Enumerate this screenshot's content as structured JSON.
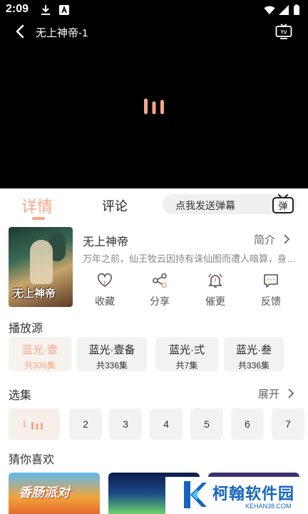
{
  "status_bar": {
    "time": "2:09"
  },
  "player": {
    "title": "无上神帝-1"
  },
  "tabs": {
    "detail": "详情",
    "comment": "评论"
  },
  "danmu": {
    "placeholder": "点我发送弹幕",
    "icon_label": "弹"
  },
  "show": {
    "poster_logo": "无上神帝",
    "title": "无上神帝",
    "intro_label": "简介",
    "description": "万年之前，仙王牧云因持有诛仙图而遭人暗算，身死道消。"
  },
  "actions": [
    {
      "label": "收藏",
      "icon": "heart-icon"
    },
    {
      "label": "分享",
      "icon": "share-icon"
    },
    {
      "label": "催更",
      "icon": "bell-icon"
    },
    {
      "label": "反馈",
      "icon": "feedback-icon"
    }
  ],
  "sources": {
    "title": "播放源",
    "items": [
      {
        "name": "蓝光·壹",
        "count": "共336集",
        "active": true
      },
      {
        "name": "蓝光·壹备",
        "count": "共336集",
        "active": false
      },
      {
        "name": "蓝光·弍",
        "count": "共7集",
        "active": false
      },
      {
        "name": "蓝光·叁",
        "count": "共336集",
        "active": false
      }
    ]
  },
  "episodes": {
    "title": "选集",
    "expand_label": "展开",
    "items": [
      "1",
      "2",
      "3",
      "4",
      "5",
      "6",
      "7"
    ],
    "current": "1"
  },
  "recommend": {
    "title": "猜你喜欢",
    "items": [
      {
        "overlay_text": "香肠派对"
      },
      {
        "overlay_text": ""
      },
      {
        "overlay_text": ""
      }
    ]
  },
  "watermark": {
    "name": "柯翰软件园",
    "url": "KEHAN38.COM"
  },
  "colors": {
    "accent": "#f4a688",
    "video_bg": "#000000",
    "chip_bg": "#f2f2f2",
    "watermark_blue": "#1565c0"
  }
}
